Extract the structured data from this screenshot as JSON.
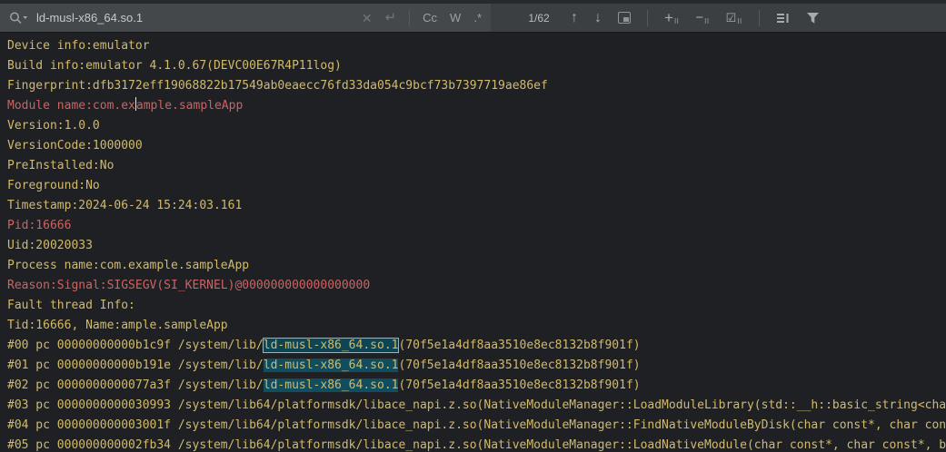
{
  "toolbar": {
    "search": {
      "query": "ld-musl-x86_64.so.1",
      "counter": "1/62",
      "clear_label": "✕",
      "newline_label": "↵",
      "toggles": {
        "match_case": "Cc",
        "whole_words": "W",
        "regex": ".*"
      },
      "nav": {
        "prev": "↑",
        "next": "↓"
      },
      "filter_ops": {
        "add": "+",
        "remove": "−",
        "check": "☑",
        "badge": "II"
      }
    }
  },
  "colors": {
    "content_bg": "#1e2023",
    "toolbar_bg": "#3c3f41",
    "field_bg": "#45484b",
    "log_info": "#d3ba6a",
    "log_error": "#cd6363",
    "match_bg": "#0f4d5f",
    "match_current_bg": "#0e4554",
    "match_border": "#9db3bd"
  },
  "log": {
    "lines": [
      {
        "color": "y",
        "parts": [
          {
            "t": "Device info:emulator"
          }
        ]
      },
      {
        "color": "y",
        "parts": [
          {
            "t": "Build info:emulator 4.1.0.67(DEVC00E67R4P11log)"
          }
        ]
      },
      {
        "color": "y",
        "parts": [
          {
            "t": "Fingerprint:dfb3172eff19068822b17549ab0eaecc76fd33da054c9bcf73b7397719ae86ef"
          }
        ]
      },
      {
        "color": "r",
        "parts": [
          {
            "t": "Module name:com.ex"
          },
          {
            "caret": true
          },
          {
            "t": "ample.sampleApp"
          }
        ]
      },
      {
        "color": "y",
        "parts": [
          {
            "t": "Version:1.0.0"
          }
        ]
      },
      {
        "color": "y",
        "parts": [
          {
            "t": "VersionCode:1000000"
          }
        ]
      },
      {
        "color": "y",
        "parts": [
          {
            "t": "PreInstalled:No"
          }
        ]
      },
      {
        "color": "y",
        "parts": [
          {
            "t": "Foreground:No"
          }
        ]
      },
      {
        "color": "y",
        "parts": [
          {
            "t": "Timestamp:2024-06-24 15:24:03.161"
          }
        ]
      },
      {
        "color": "r",
        "parts": [
          {
            "t": "Pid:16666"
          }
        ]
      },
      {
        "color": "y",
        "parts": [
          {
            "t": "Uid:20020033"
          }
        ]
      },
      {
        "color": "y",
        "parts": [
          {
            "t": "Process name:com.example.sampleApp"
          }
        ]
      },
      {
        "color": "r",
        "parts": [
          {
            "t": "Reason:Signal:SIGSEGV(SI_KERNEL)@000000000000000000"
          }
        ]
      },
      {
        "color": "y",
        "parts": [
          {
            "t": "Fault thread Info:"
          }
        ]
      },
      {
        "color": "y",
        "parts": [
          {
            "t": "Tid:16666, Name:ample.sampleApp"
          }
        ]
      },
      {
        "color": "y",
        "parts": [
          {
            "t": "#00 pc 00000000000b1c9f /system/lib/"
          },
          {
            "t": "ld-musl-x86_64.so.1",
            "hl": "current"
          },
          {
            "t": "(70f5e1a4df8aa3510e8ec8132b8f901f)"
          }
        ]
      },
      {
        "color": "y",
        "parts": [
          {
            "t": "#01 pc 00000000000b191e /system/lib/"
          },
          {
            "t": "ld-musl-x86_64.so.1",
            "hl": "match"
          },
          {
            "t": "(70f5e1a4df8aa3510e8ec8132b8f901f)"
          }
        ]
      },
      {
        "color": "y",
        "parts": [
          {
            "t": "#02 pc 0000000000077a3f /system/lib/"
          },
          {
            "t": "ld-musl-x86_64.so.1",
            "hl": "match"
          },
          {
            "t": "(70f5e1a4df8aa3510e8ec8132b8f901f)"
          }
        ]
      },
      {
        "color": "y",
        "parts": [
          {
            "t": "#03 pc 0000000000030993 /system/lib64/platformsdk/libace_napi.z.so(NativeModuleManager::LoadModuleLibrary(std::__h::basic_string<char"
          }
        ]
      },
      {
        "color": "y",
        "parts": [
          {
            "t": "#04 pc 000000000003001f /system/lib64/platformsdk/libace_napi.z.so(NativeModuleManager::FindNativeModuleByDisk(char const*, char cons"
          }
        ]
      },
      {
        "color": "y",
        "parts": [
          {
            "t": "#05 pc 000000000002fb34 /system/lib64/platformsdk/libace_napi.z.so(NativeModuleManager::LoadNativeModule(char const*, char const*, bo"
          }
        ]
      }
    ]
  }
}
